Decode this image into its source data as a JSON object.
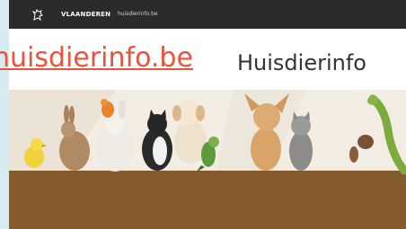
{
  "header": {
    "gov_name": "VLAANDEREN",
    "breadcrumb": "huisdierinfo.be"
  },
  "main": {
    "site_link": "huisdierinfo.be",
    "site_title": "Huisdierinfo"
  },
  "colors": {
    "topbar": "#2b2b2b",
    "link": "#e8533a",
    "brown_band": "#855a2f",
    "banner_bg": "#f2ece2"
  }
}
